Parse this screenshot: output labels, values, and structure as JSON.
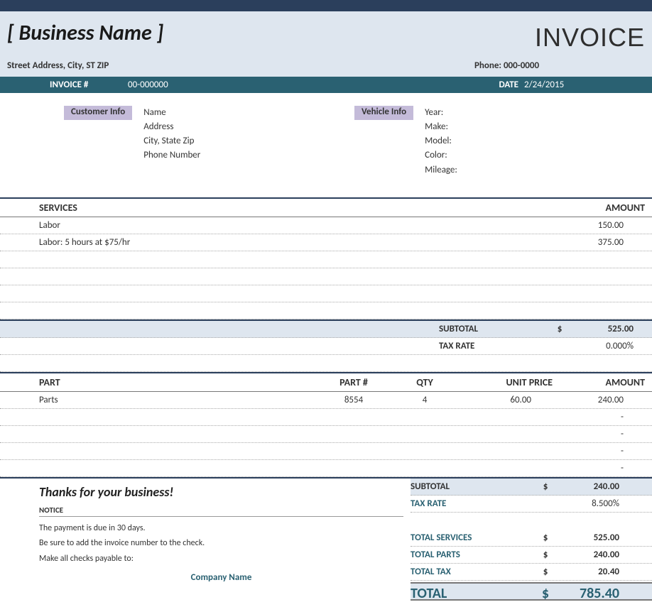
{
  "header": {
    "business_name": "[ Business Name ]",
    "invoice_word": "INVOICE",
    "address": "Street Address, City, ST ZIP",
    "phone_label": "Phone:",
    "phone": "000-0000"
  },
  "meta": {
    "invoice_label": "INVOICE #",
    "invoice_number": "00-000000",
    "date_label": "DATE",
    "date": "2/24/2015"
  },
  "customer": {
    "pill": "Customer Info",
    "lines": [
      "Name",
      "Address",
      "City, State  Zip",
      "Phone Number"
    ]
  },
  "vehicle": {
    "pill": "Vehicle Info",
    "lines": [
      "Year:",
      "Make:",
      "Model:",
      "Color:",
      "Mileage:"
    ]
  },
  "services_header": {
    "services": "SERVICES",
    "amount": "AMOUNT"
  },
  "services": [
    {
      "desc": "Labor",
      "amount": "150.00"
    },
    {
      "desc": "Labor: 5 hours at $75/hr",
      "amount": "375.00"
    },
    {
      "desc": "",
      "amount": ""
    },
    {
      "desc": "",
      "amount": ""
    },
    {
      "desc": "",
      "amount": ""
    },
    {
      "desc": "",
      "amount": ""
    }
  ],
  "services_totals": {
    "subtotal_label": "SUBTOTAL",
    "subtotal_cur": "$",
    "subtotal": "525.00",
    "taxrate_label": "TAX RATE",
    "taxrate": "0.000%"
  },
  "parts_header": {
    "part": "PART",
    "partnum": "PART  #",
    "qty": "QTY",
    "unitprice": "UNIT PRICE",
    "amount": "AMOUNT"
  },
  "parts": [
    {
      "desc": "Parts",
      "num": "8554",
      "qty": "4",
      "uprice": "60.00",
      "amount": "240.00"
    },
    {
      "desc": "",
      "num": "",
      "qty": "",
      "uprice": "",
      "amount": "-"
    },
    {
      "desc": "",
      "num": "",
      "qty": "",
      "uprice": "",
      "amount": "-"
    },
    {
      "desc": "",
      "num": "",
      "qty": "",
      "uprice": "",
      "amount": "-"
    },
    {
      "desc": "",
      "num": "",
      "qty": "",
      "uprice": "",
      "amount": "-"
    }
  ],
  "parts_totals": {
    "subtotal_label": "SUBTOTAL",
    "subtotal_cur": "$",
    "subtotal": "240.00",
    "taxrate_label": "TAX RATE",
    "taxrate": "8.500%"
  },
  "footer": {
    "thanks": "Thanks for your business!",
    "notice_hdr": "NOTICE",
    "notice_lines": [
      "The payment is due in 30 days.",
      "Be sure to add the invoice number to the check.",
      "Make all checks payable to:"
    ],
    "company_name": "Company Name"
  },
  "grand": {
    "total_services_label": "TOTAL SERVICES",
    "total_services_cur": "$",
    "total_services": "525.00",
    "total_parts_label": "TOTAL PARTS",
    "total_parts_cur": "$",
    "total_parts": "240.00",
    "total_tax_label": "TOTAL TAX",
    "total_tax_cur": "$",
    "total_tax": "20.40",
    "total_label": "TOTAL",
    "total_cur": "$",
    "total": "785.40"
  }
}
